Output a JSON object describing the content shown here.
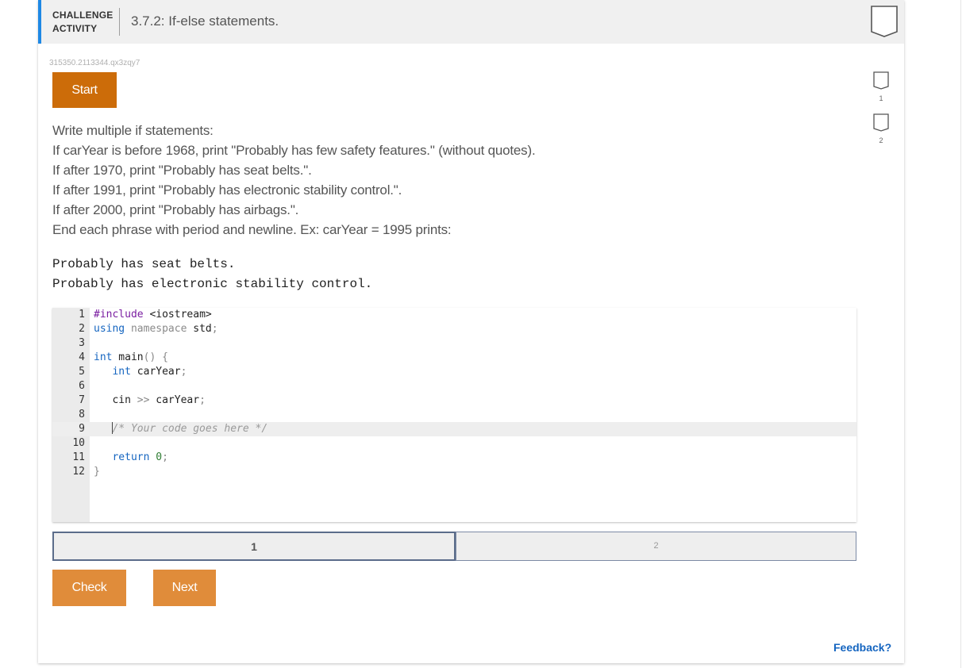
{
  "header": {
    "kind_line1": "CHALLENGE",
    "kind_line2": "ACTIVITY",
    "title": "3.7.2: If-else statements."
  },
  "activity_id": "315350.2113344.qx3zqy7",
  "start_label": "Start",
  "instructions": [
    "Write multiple if statements:",
    "If carYear is before 1968, print \"Probably has few safety features.\" (without quotes).",
    "If after 1970, print \"Probably has seat belts.\".",
    "If after 1991, print \"Probably has electronic stability control.\".",
    "If after 2000, print \"Probably has airbags.\".",
    "End each phrase with period and newline. Ex: carYear = 1995 prints:"
  ],
  "example_output": [
    "Probably has seat belts.",
    "Probably has electronic stability control."
  ],
  "editor": {
    "line_numbers": [
      "1",
      "2",
      "3",
      "4",
      "5",
      "6",
      "7",
      "8",
      "9",
      "10",
      "11",
      "12"
    ],
    "active_line": 9,
    "lines": {
      "l1": {
        "pre": "#include",
        "rest": " <iostream>"
      },
      "l2": {
        "kw": "using",
        "ns": " namespace",
        "id": " std",
        "pun": ";"
      },
      "l4": {
        "kw": "int",
        "id": " main",
        "pun": "() {"
      },
      "l5": {
        "kw": "int",
        "id": " carYear",
        "pun": ";"
      },
      "l7": {
        "id": "cin",
        "op": " >>",
        "id2": " carYear",
        "pun": ";"
      },
      "l9": {
        "cmt": "/* Your code goes here */"
      },
      "l11": {
        "kw": "return",
        "num": " 0",
        "pun": ";"
      },
      "l12": {
        "pun": "}"
      }
    }
  },
  "levels": [
    {
      "label": "1",
      "state": "current"
    },
    {
      "label": "2",
      "state": "locked"
    }
  ],
  "side_levels": [
    "1",
    "2"
  ],
  "check_label": "Check",
  "next_label": "Next",
  "feedback_label": "Feedback?",
  "colors": {
    "accent_blue": "#1e88e5",
    "start_orange": "#cc6c09",
    "button_orange": "#e08c3a",
    "link_blue": "#1565c0"
  }
}
